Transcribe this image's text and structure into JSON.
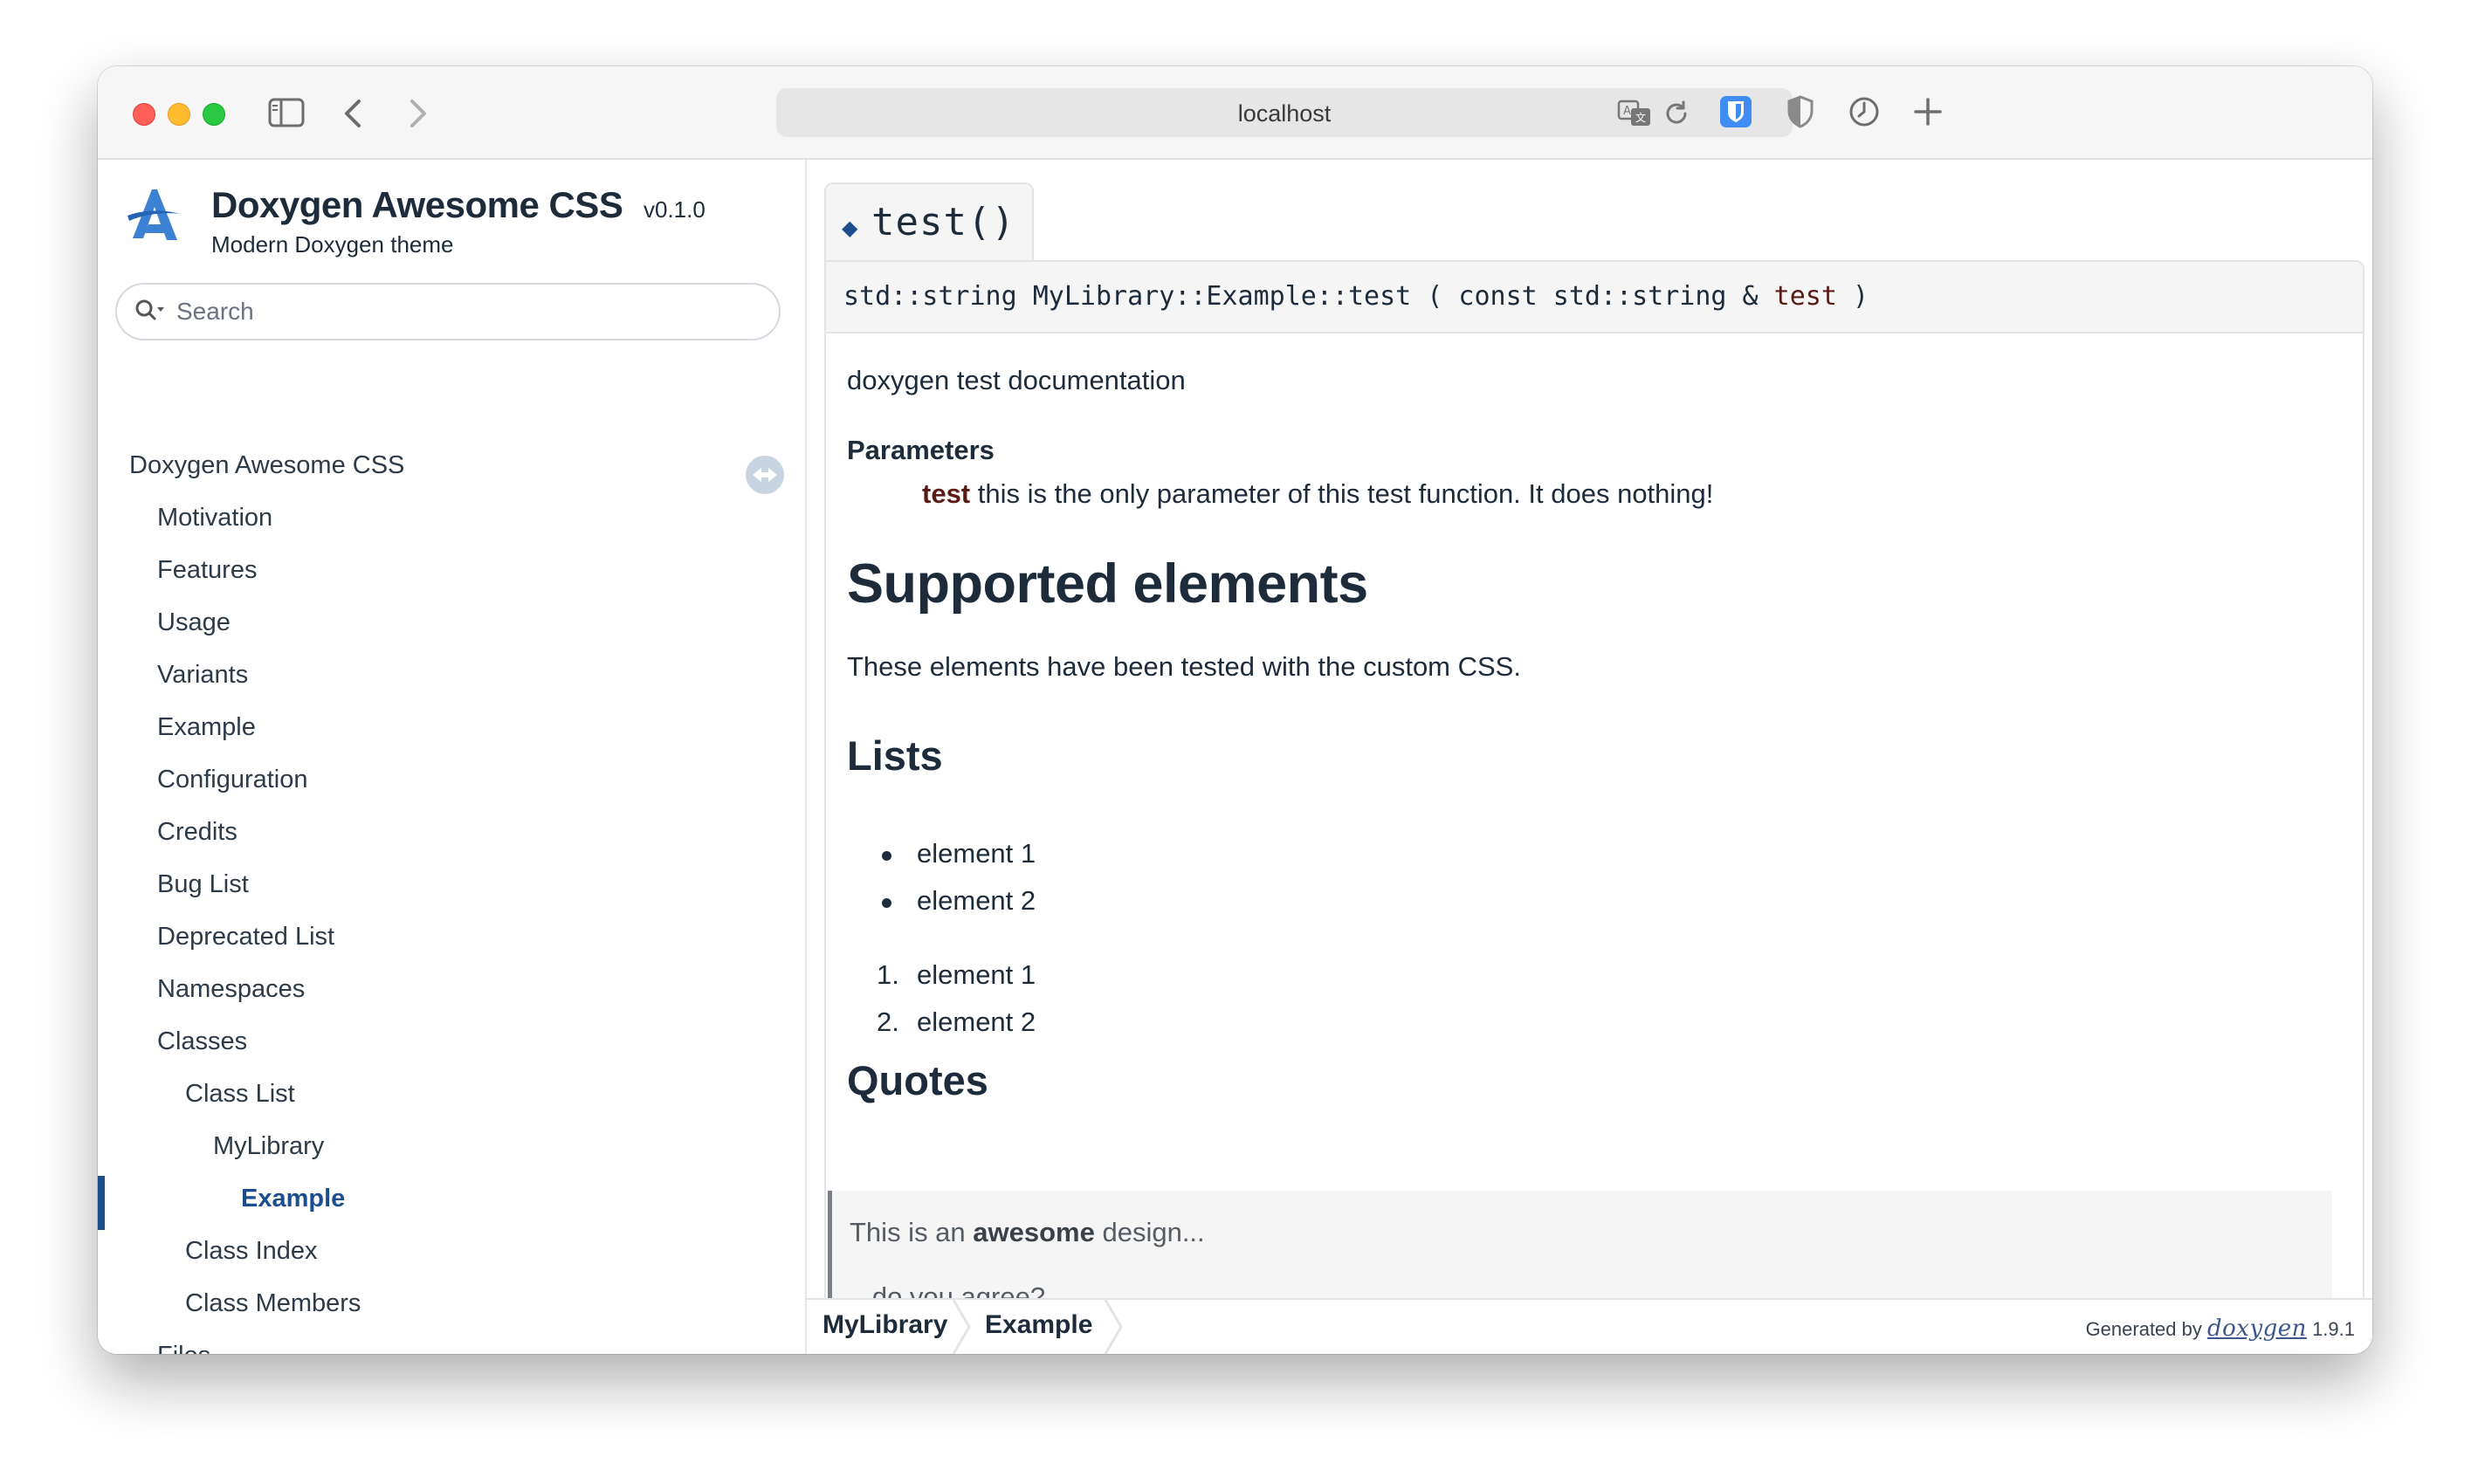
{
  "browser": {
    "url": "localhost"
  },
  "project": {
    "name": "Doxygen Awesome CSS",
    "version": "v0.1.0",
    "brief": "Modern Doxygen theme"
  },
  "search": {
    "placeholder": "Search"
  },
  "nav": {
    "items": [
      {
        "label": "Doxygen Awesome CSS",
        "level": 0
      },
      {
        "label": "Motivation",
        "level": 1
      },
      {
        "label": "Features",
        "level": 1
      },
      {
        "label": "Usage",
        "level": 1
      },
      {
        "label": "Variants",
        "level": 1
      },
      {
        "label": "Example",
        "level": 1
      },
      {
        "label": "Configuration",
        "level": 1
      },
      {
        "label": "Credits",
        "level": 1
      },
      {
        "label": "Bug List",
        "level": 1
      },
      {
        "label": "Deprecated List",
        "level": 1
      },
      {
        "label": "Namespaces",
        "level": 1
      },
      {
        "label": "Classes",
        "level": 1
      },
      {
        "label": "Class List",
        "level": 2
      },
      {
        "label": "MyLibrary",
        "level": 3
      },
      {
        "label": "Example",
        "level": 4,
        "active": true
      },
      {
        "label": "Class Index",
        "level": 2
      },
      {
        "label": "Class Members",
        "level": 2
      },
      {
        "label": "Files",
        "level": 1
      }
    ]
  },
  "member": {
    "title": "test()",
    "proto_prefix": "std::string MyLibrary::Example::test ( const std::string & ",
    "proto_param": "test",
    "proto_suffix": " )",
    "description": "doxygen test documentation",
    "params_heading": "Parameters",
    "param_name": "test",
    "param_desc": "this is the only parameter of this test function. It does nothing!"
  },
  "doc": {
    "supported_heading": "Supported elements",
    "supported_text": "These elements have been tested with the custom CSS.",
    "lists_heading": "Lists",
    "unordered": [
      "element 1",
      "element 2"
    ],
    "ordered": [
      "element 1",
      "element 2"
    ],
    "ordered_markers": [
      "1.",
      "2."
    ],
    "quotes_heading": "Quotes",
    "quote_line1_pre": "This is an ",
    "quote_line1_bold": "awesome",
    "quote_line1_post": " design...",
    "quote_line2": "...do you agree?"
  },
  "footer": {
    "breadcrumbs": [
      "MyLibrary",
      "Example"
    ],
    "generated_by": "Generated by",
    "doxygen_logo": "doxygen",
    "doxygen_version": "1.9.1"
  },
  "colors": {
    "accent": "#1c4e8d",
    "param": "#5a1b16",
    "text": "#1d2b3a"
  }
}
